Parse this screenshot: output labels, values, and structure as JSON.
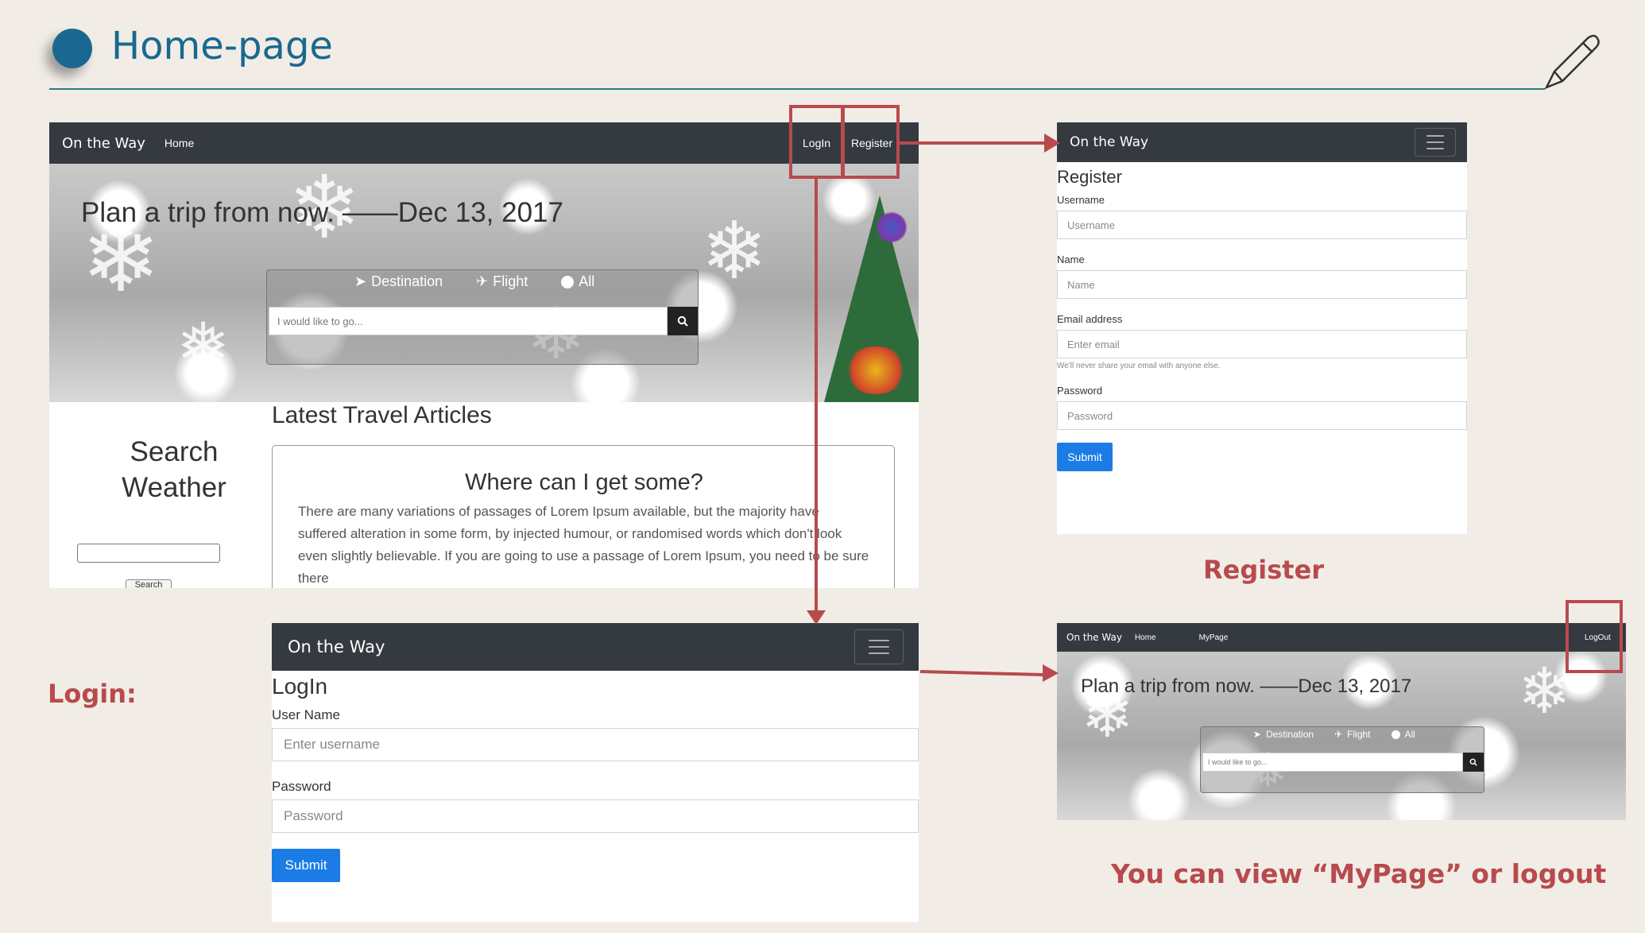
{
  "slide": {
    "title": "Home-page",
    "colors": {
      "accent": "#1a6890",
      "annotation": "#b84a4e",
      "navbar": "#343a40",
      "button": "#1b7ce5"
    }
  },
  "home": {
    "brand": "On the Way",
    "nav_home": "Home",
    "nav_login": "LogIn",
    "nav_register": "Register",
    "hero_title": "Plan a trip from now. ——Dec 13, 2017",
    "search": {
      "opt_destination": "Destination",
      "opt_flight": "Flight",
      "opt_all": "All",
      "placeholder": "I would like to go...",
      "icon": "search-icon"
    },
    "articles_heading": "Latest Travel Articles",
    "article": {
      "title": "Where can I get some?",
      "body": "There are many variations of passages of Lorem Ipsum available, but the majority have suffered alteration in some form, by injected humour, or randomised words which don't look even slightly believable. If you are going to use a passage of Lorem Ipsum, you need to be sure there"
    },
    "weather_heading": "Search Weather",
    "weather_button": "Search"
  },
  "register": {
    "brand": "On the Way",
    "heading": "Register",
    "username_label": "Username",
    "username_placeholder": "Username",
    "name_label": "Name",
    "name_placeholder": "Name",
    "email_label": "Email address",
    "email_placeholder": "Enter email",
    "email_help": "We'll never share your email with anyone else.",
    "password_label": "Password",
    "password_placeholder": "Password",
    "submit": "Submit",
    "caption": "Register"
  },
  "login": {
    "brand": "On the Way",
    "heading": "LogIn",
    "username_label": "User Name",
    "username_placeholder": "Enter username",
    "password_label": "Password",
    "password_placeholder": "Password",
    "submit": "Submit",
    "caption": "Login:"
  },
  "mypage": {
    "brand": "On the Way",
    "nav_home": "Home",
    "nav_mypage": "MyPage",
    "nav_logout": "LogOut",
    "hero_title": "Plan a trip from now. ——Dec 13, 2017",
    "opt_destination": "Destination",
    "opt_flight": "Flight",
    "opt_all": "All",
    "placeholder": "I would like to go...",
    "caption": "You can view “MyPage” or logout"
  }
}
